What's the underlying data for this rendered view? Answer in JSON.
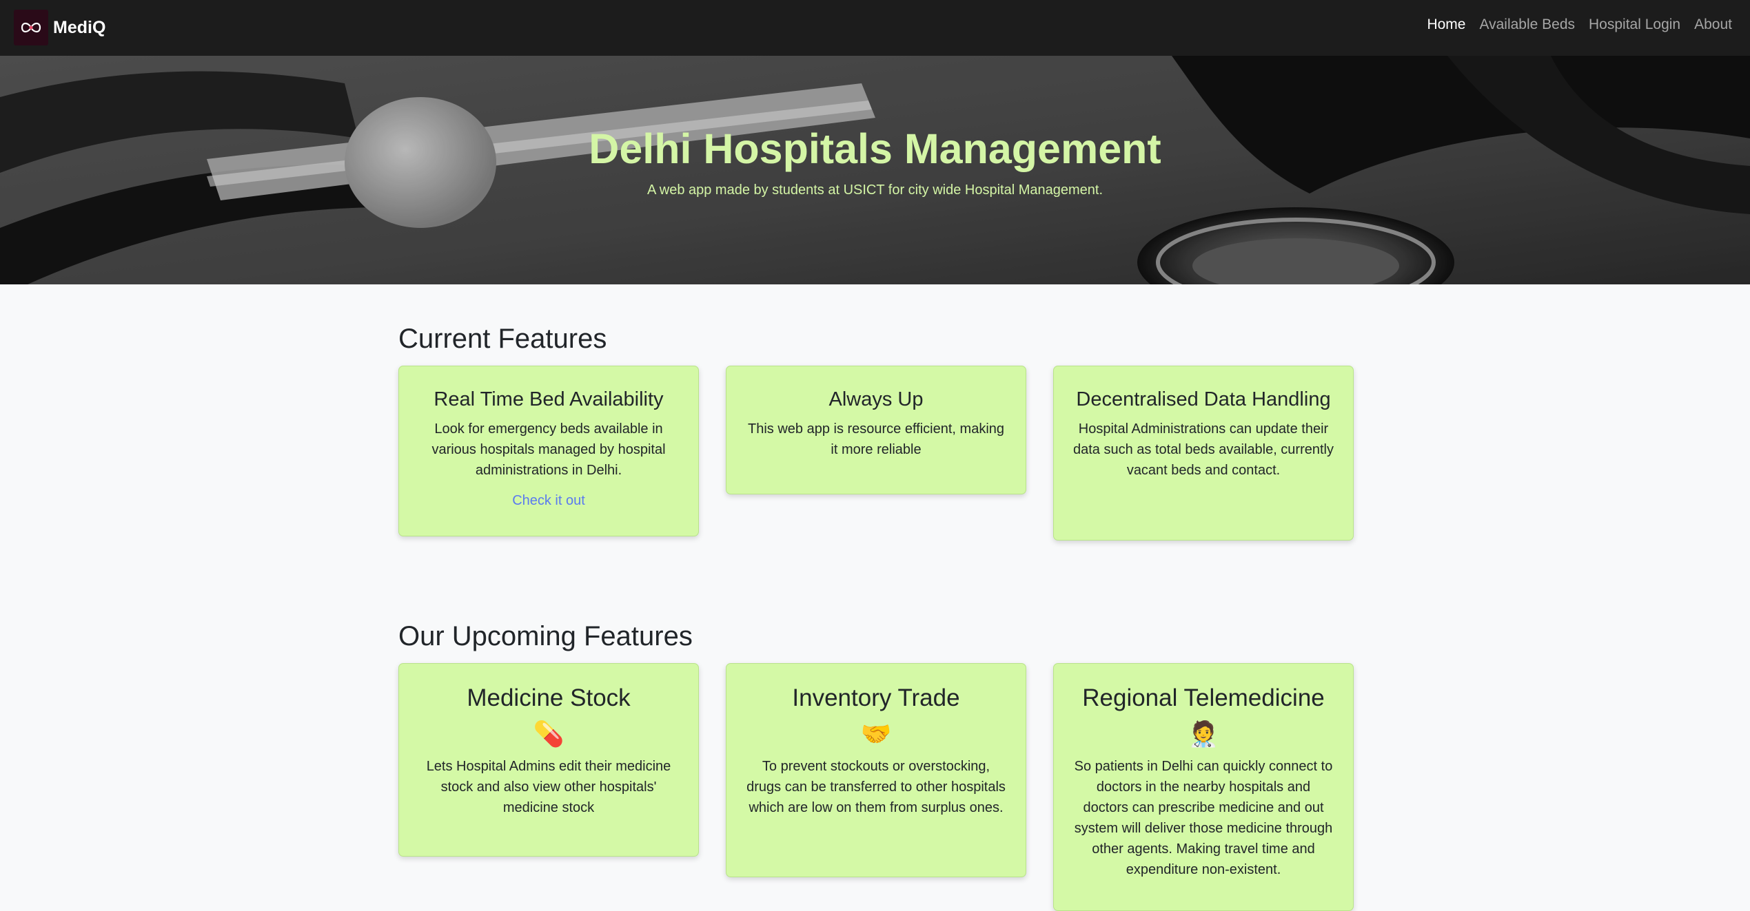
{
  "navbar": {
    "brand": "MediQ",
    "links": [
      "Home",
      "Available Beds",
      "Hospital Login",
      "About"
    ]
  },
  "hero": {
    "title": "Delhi Hospitals Management",
    "subtitle": "A web app made by students at USICT for city wide Hospital Management."
  },
  "current": {
    "heading": "Current Features",
    "cards": [
      {
        "title": "Real Time Bed Availability",
        "text": "Look for emergency beds available in various hospitals managed by hospital administrations in Delhi.",
        "link": "Check it out"
      },
      {
        "title": "Always Up",
        "text": "This web app is resource efficient, making it more reliable"
      },
      {
        "title": "Decentralised Data Handling",
        "text": "Hospital Administrations can update their data such as total beds available, currently vacant beds and contact."
      }
    ]
  },
  "upcoming": {
    "heading": "Our Upcoming Features",
    "cards": [
      {
        "title": "Medicine Stock",
        "emoji": "💊",
        "text": "Lets Hospital Admins edit their medicine stock and also view other hospitals' medicine stock"
      },
      {
        "title": "Inventory Trade",
        "emoji": "🤝",
        "text": "To prevent stockouts or overstocking, drugs can be transferred to other hospitals which are low on them from surplus ones."
      },
      {
        "title": "Regional Telemedicine",
        "emoji": "🧑‍⚕️",
        "text": "So patients in Delhi can quickly connect to doctors in the nearby hospitals and doctors can prescribe medicine and out system will deliver those medicine through other agents. Making travel time and expenditure non-existent."
      }
    ]
  }
}
